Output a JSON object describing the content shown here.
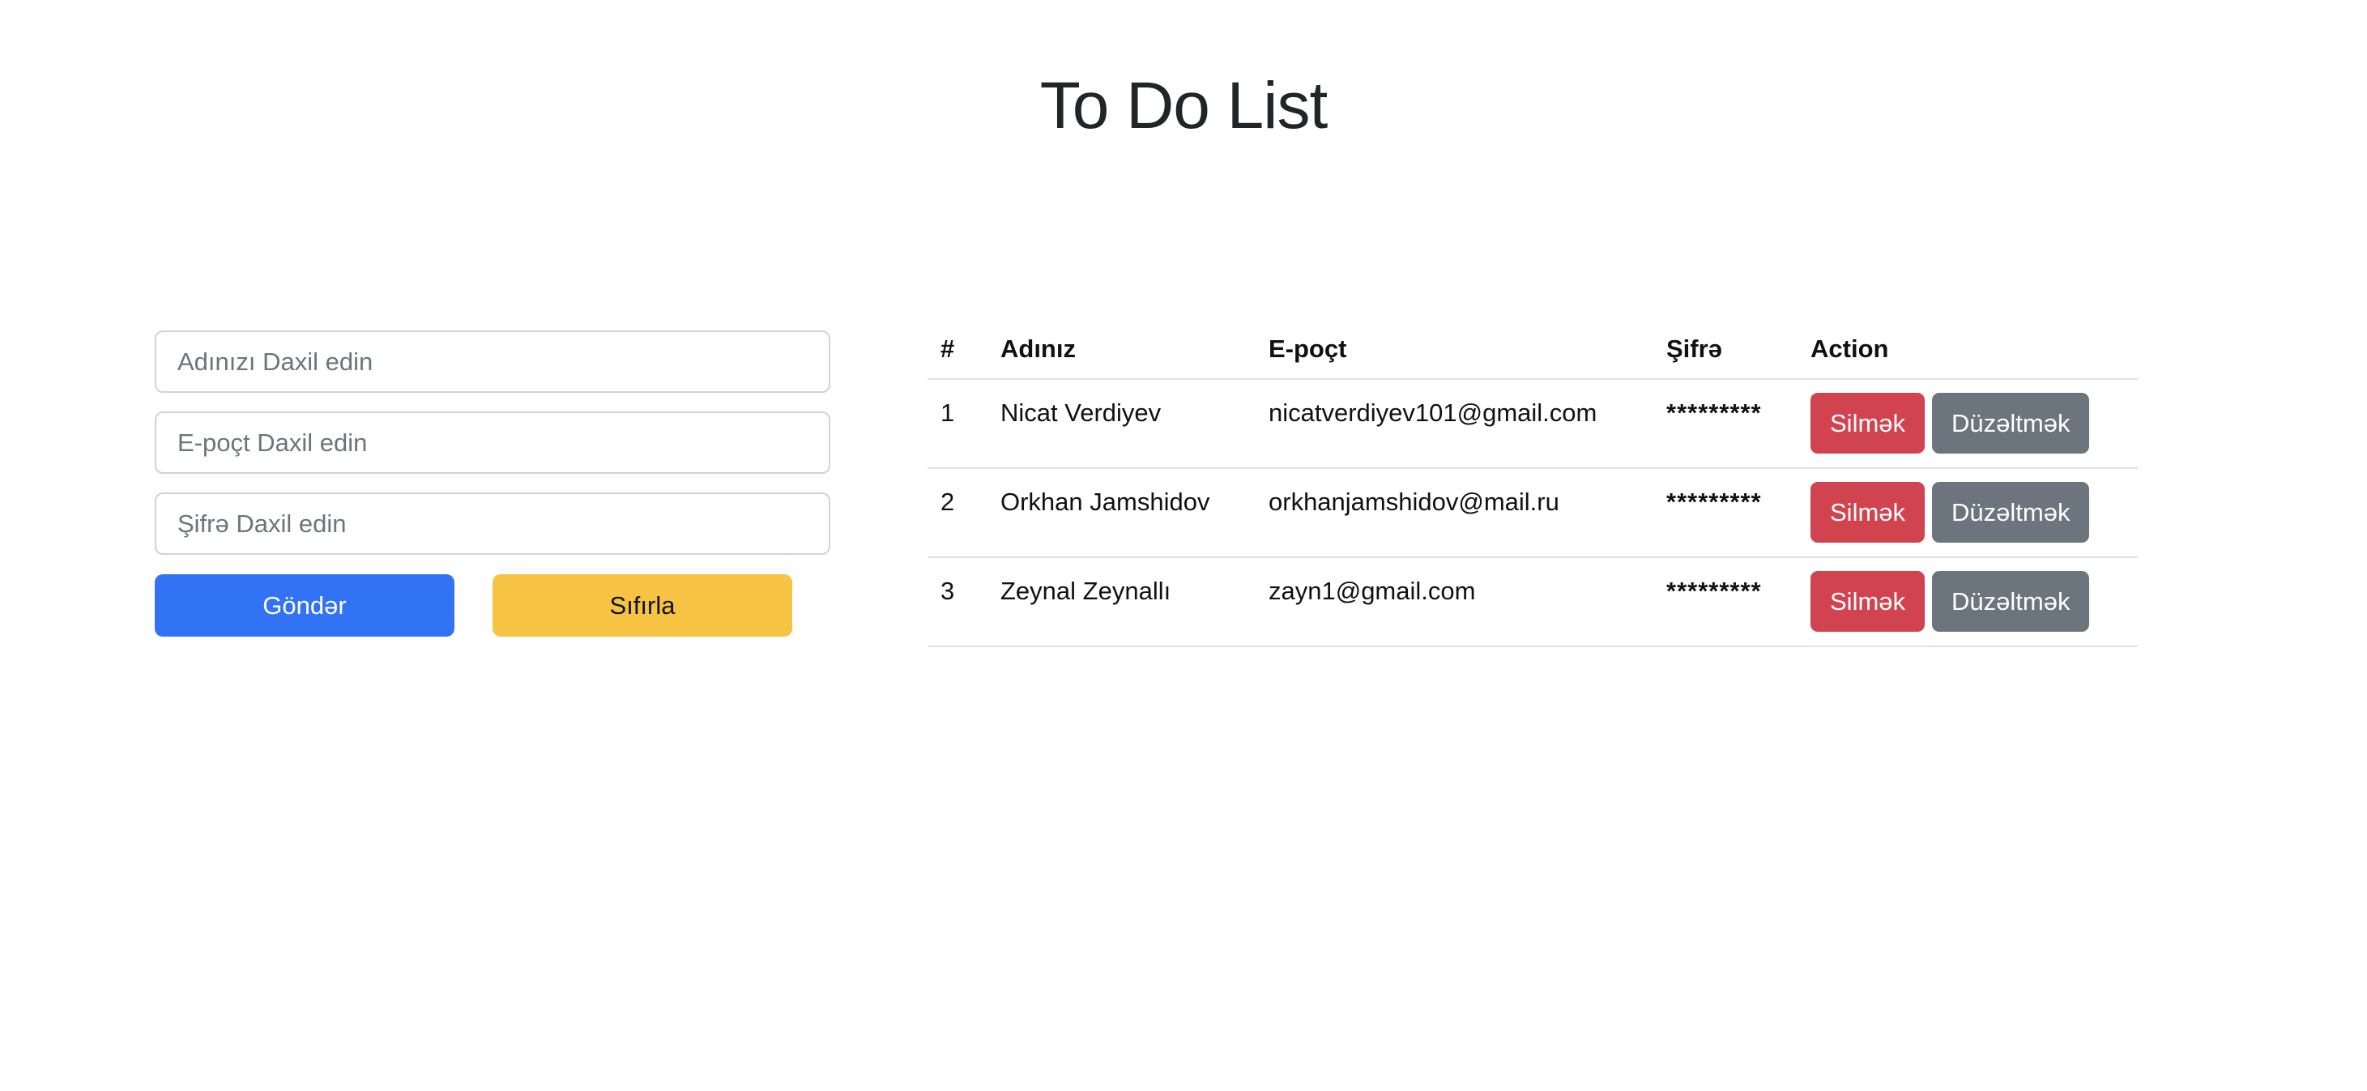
{
  "header": {
    "title": "To Do List"
  },
  "form": {
    "name_placeholder": "Adınızı Daxil edin",
    "email_placeholder": "E-poçt Daxil edin",
    "password_placeholder": "Şifrə Daxil edin",
    "submit_label": "Göndər",
    "reset_label": "Sıfırla"
  },
  "table": {
    "headers": [
      "#",
      "Adınız",
      "E-poçt",
      "Şifrə",
      "Action"
    ],
    "rows": [
      {
        "num": "1",
        "name": "Nicat Verdiyev",
        "email": "nicatverdiyev101@gmail.com",
        "password": "*********",
        "delete_label": "Silmək",
        "edit_label": "Düzəltmək"
      },
      {
        "num": "2",
        "name": "Orkhan Jamshidov",
        "email": "orkhanjamshidov@mail.ru",
        "password": "*********",
        "delete_label": "Silmək",
        "edit_label": "Düzəltmək"
      },
      {
        "num": "3",
        "name": "Zeynal Zeynallı",
        "email": "zayn1@gmail.com",
        "password": "*********",
        "delete_label": "Silmək",
        "edit_label": "Düzəltmək"
      }
    ]
  },
  "colors": {
    "primary": "#3272f5",
    "warning": "#f6c343",
    "danger": "#d1434f",
    "secondary": "#6c757d"
  }
}
